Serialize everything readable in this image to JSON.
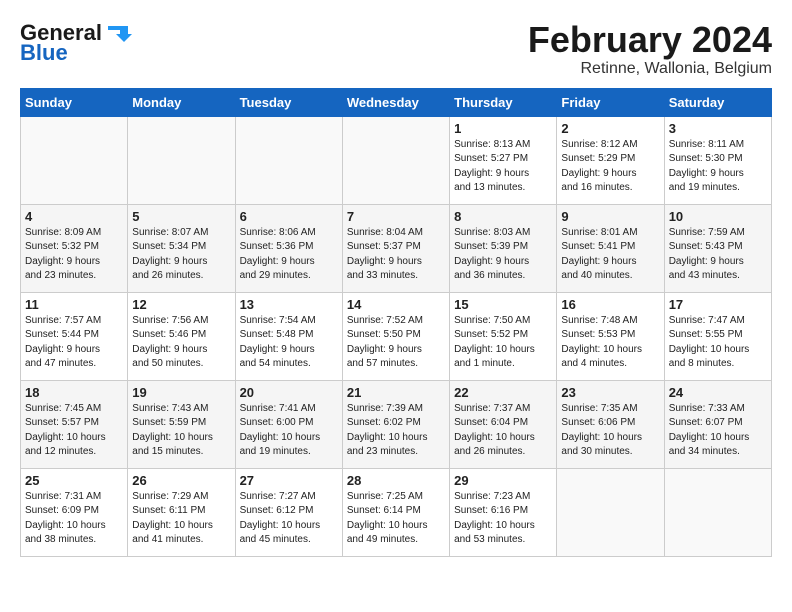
{
  "header": {
    "logo_general": "General",
    "logo_blue": "Blue",
    "month_year": "February 2024",
    "location": "Retinne, Wallonia, Belgium"
  },
  "days_of_week": [
    "Sunday",
    "Monday",
    "Tuesday",
    "Wednesday",
    "Thursday",
    "Friday",
    "Saturday"
  ],
  "weeks": [
    [
      {
        "day": "",
        "info": ""
      },
      {
        "day": "",
        "info": ""
      },
      {
        "day": "",
        "info": ""
      },
      {
        "day": "",
        "info": ""
      },
      {
        "day": "1",
        "info": "Sunrise: 8:13 AM\nSunset: 5:27 PM\nDaylight: 9 hours\nand 13 minutes."
      },
      {
        "day": "2",
        "info": "Sunrise: 8:12 AM\nSunset: 5:29 PM\nDaylight: 9 hours\nand 16 minutes."
      },
      {
        "day": "3",
        "info": "Sunrise: 8:11 AM\nSunset: 5:30 PM\nDaylight: 9 hours\nand 19 minutes."
      }
    ],
    [
      {
        "day": "4",
        "info": "Sunrise: 8:09 AM\nSunset: 5:32 PM\nDaylight: 9 hours\nand 23 minutes."
      },
      {
        "day": "5",
        "info": "Sunrise: 8:07 AM\nSunset: 5:34 PM\nDaylight: 9 hours\nand 26 minutes."
      },
      {
        "day": "6",
        "info": "Sunrise: 8:06 AM\nSunset: 5:36 PM\nDaylight: 9 hours\nand 29 minutes."
      },
      {
        "day": "7",
        "info": "Sunrise: 8:04 AM\nSunset: 5:37 PM\nDaylight: 9 hours\nand 33 minutes."
      },
      {
        "day": "8",
        "info": "Sunrise: 8:03 AM\nSunset: 5:39 PM\nDaylight: 9 hours\nand 36 minutes."
      },
      {
        "day": "9",
        "info": "Sunrise: 8:01 AM\nSunset: 5:41 PM\nDaylight: 9 hours\nand 40 minutes."
      },
      {
        "day": "10",
        "info": "Sunrise: 7:59 AM\nSunset: 5:43 PM\nDaylight: 9 hours\nand 43 minutes."
      }
    ],
    [
      {
        "day": "11",
        "info": "Sunrise: 7:57 AM\nSunset: 5:44 PM\nDaylight: 9 hours\nand 47 minutes."
      },
      {
        "day": "12",
        "info": "Sunrise: 7:56 AM\nSunset: 5:46 PM\nDaylight: 9 hours\nand 50 minutes."
      },
      {
        "day": "13",
        "info": "Sunrise: 7:54 AM\nSunset: 5:48 PM\nDaylight: 9 hours\nand 54 minutes."
      },
      {
        "day": "14",
        "info": "Sunrise: 7:52 AM\nSunset: 5:50 PM\nDaylight: 9 hours\nand 57 minutes."
      },
      {
        "day": "15",
        "info": "Sunrise: 7:50 AM\nSunset: 5:52 PM\nDaylight: 10 hours\nand 1 minute."
      },
      {
        "day": "16",
        "info": "Sunrise: 7:48 AM\nSunset: 5:53 PM\nDaylight: 10 hours\nand 4 minutes."
      },
      {
        "day": "17",
        "info": "Sunrise: 7:47 AM\nSunset: 5:55 PM\nDaylight: 10 hours\nand 8 minutes."
      }
    ],
    [
      {
        "day": "18",
        "info": "Sunrise: 7:45 AM\nSunset: 5:57 PM\nDaylight: 10 hours\nand 12 minutes."
      },
      {
        "day": "19",
        "info": "Sunrise: 7:43 AM\nSunset: 5:59 PM\nDaylight: 10 hours\nand 15 minutes."
      },
      {
        "day": "20",
        "info": "Sunrise: 7:41 AM\nSunset: 6:00 PM\nDaylight: 10 hours\nand 19 minutes."
      },
      {
        "day": "21",
        "info": "Sunrise: 7:39 AM\nSunset: 6:02 PM\nDaylight: 10 hours\nand 23 minutes."
      },
      {
        "day": "22",
        "info": "Sunrise: 7:37 AM\nSunset: 6:04 PM\nDaylight: 10 hours\nand 26 minutes."
      },
      {
        "day": "23",
        "info": "Sunrise: 7:35 AM\nSunset: 6:06 PM\nDaylight: 10 hours\nand 30 minutes."
      },
      {
        "day": "24",
        "info": "Sunrise: 7:33 AM\nSunset: 6:07 PM\nDaylight: 10 hours\nand 34 minutes."
      }
    ],
    [
      {
        "day": "25",
        "info": "Sunrise: 7:31 AM\nSunset: 6:09 PM\nDaylight: 10 hours\nand 38 minutes."
      },
      {
        "day": "26",
        "info": "Sunrise: 7:29 AM\nSunset: 6:11 PM\nDaylight: 10 hours\nand 41 minutes."
      },
      {
        "day": "27",
        "info": "Sunrise: 7:27 AM\nSunset: 6:12 PM\nDaylight: 10 hours\nand 45 minutes."
      },
      {
        "day": "28",
        "info": "Sunrise: 7:25 AM\nSunset: 6:14 PM\nDaylight: 10 hours\nand 49 minutes."
      },
      {
        "day": "29",
        "info": "Sunrise: 7:23 AM\nSunset: 6:16 PM\nDaylight: 10 hours\nand 53 minutes."
      },
      {
        "day": "",
        "info": ""
      },
      {
        "day": "",
        "info": ""
      }
    ]
  ]
}
